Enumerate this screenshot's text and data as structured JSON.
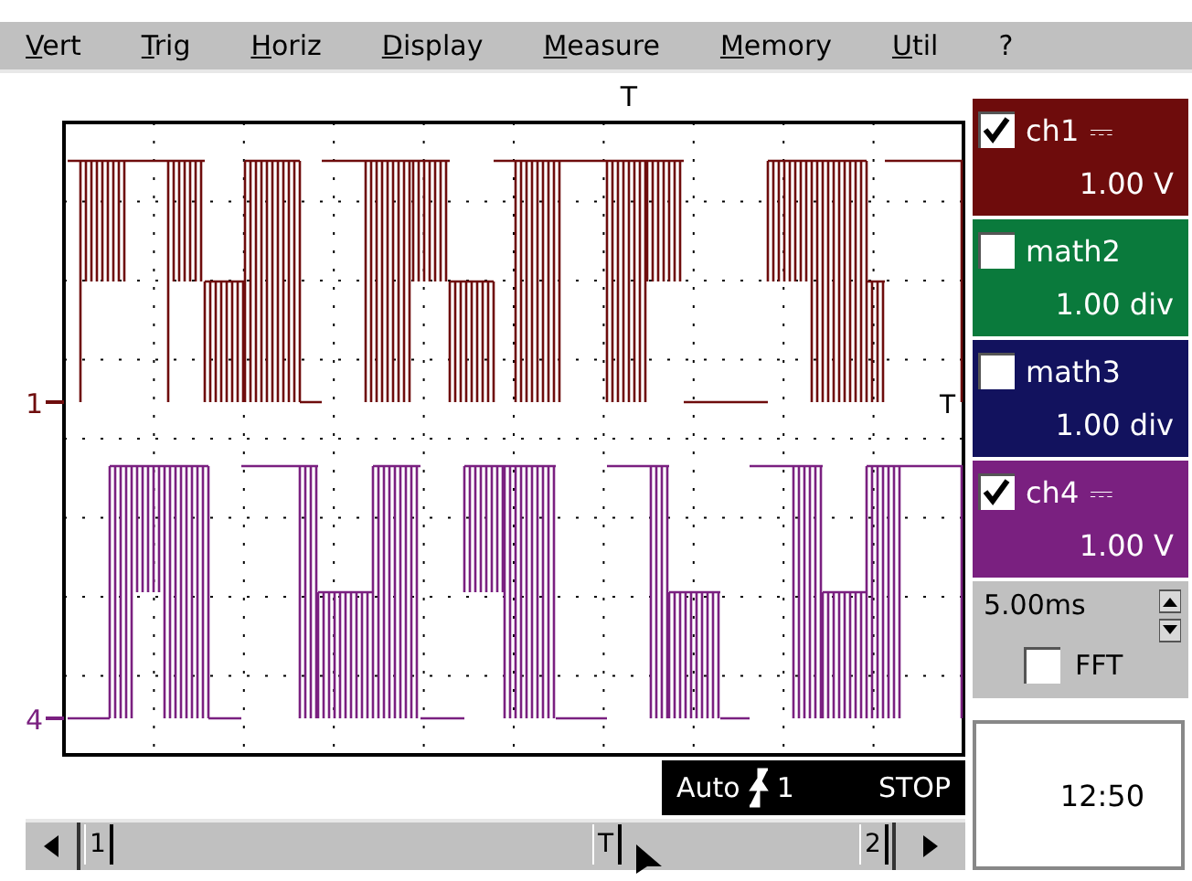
{
  "menu": [
    {
      "label": "Vert"
    },
    {
      "label": "Trig"
    },
    {
      "label": "Horiz"
    },
    {
      "label": "Display"
    },
    {
      "label": "Measure"
    },
    {
      "label": "Memory"
    },
    {
      "label": "Util"
    },
    {
      "label": "?"
    }
  ],
  "plot": {
    "trigger_marker": "T",
    "trace_end_marker": "T",
    "channel_markers": [
      {
        "label": "1",
        "color": "#6e0c0c"
      },
      {
        "label": "4",
        "color": "#7a2080"
      }
    ]
  },
  "channels": [
    {
      "name": "ch1",
      "coupling": "⎓",
      "scale": "1.00 V",
      "checked": true,
      "color": "#6e0c0c"
    },
    {
      "name": "math2",
      "scale": "1.00 div",
      "checked": false,
      "color": "#0a7a3c"
    },
    {
      "name": "math3",
      "scale": "1.00 div",
      "checked": false,
      "color": "#12125e"
    },
    {
      "name": "ch4",
      "coupling": "⎓",
      "scale": "1.00 V",
      "checked": true,
      "color": "#7a2080"
    }
  ],
  "timebase": {
    "value": "5.00ms"
  },
  "fft": {
    "label": "FFT",
    "checked": false
  },
  "status": {
    "mode": "Auto",
    "trigger_source": "1",
    "state": "STOP"
  },
  "clock": "12:50",
  "scrollbar": {
    "markers": [
      "1",
      "T",
      "2"
    ]
  }
}
